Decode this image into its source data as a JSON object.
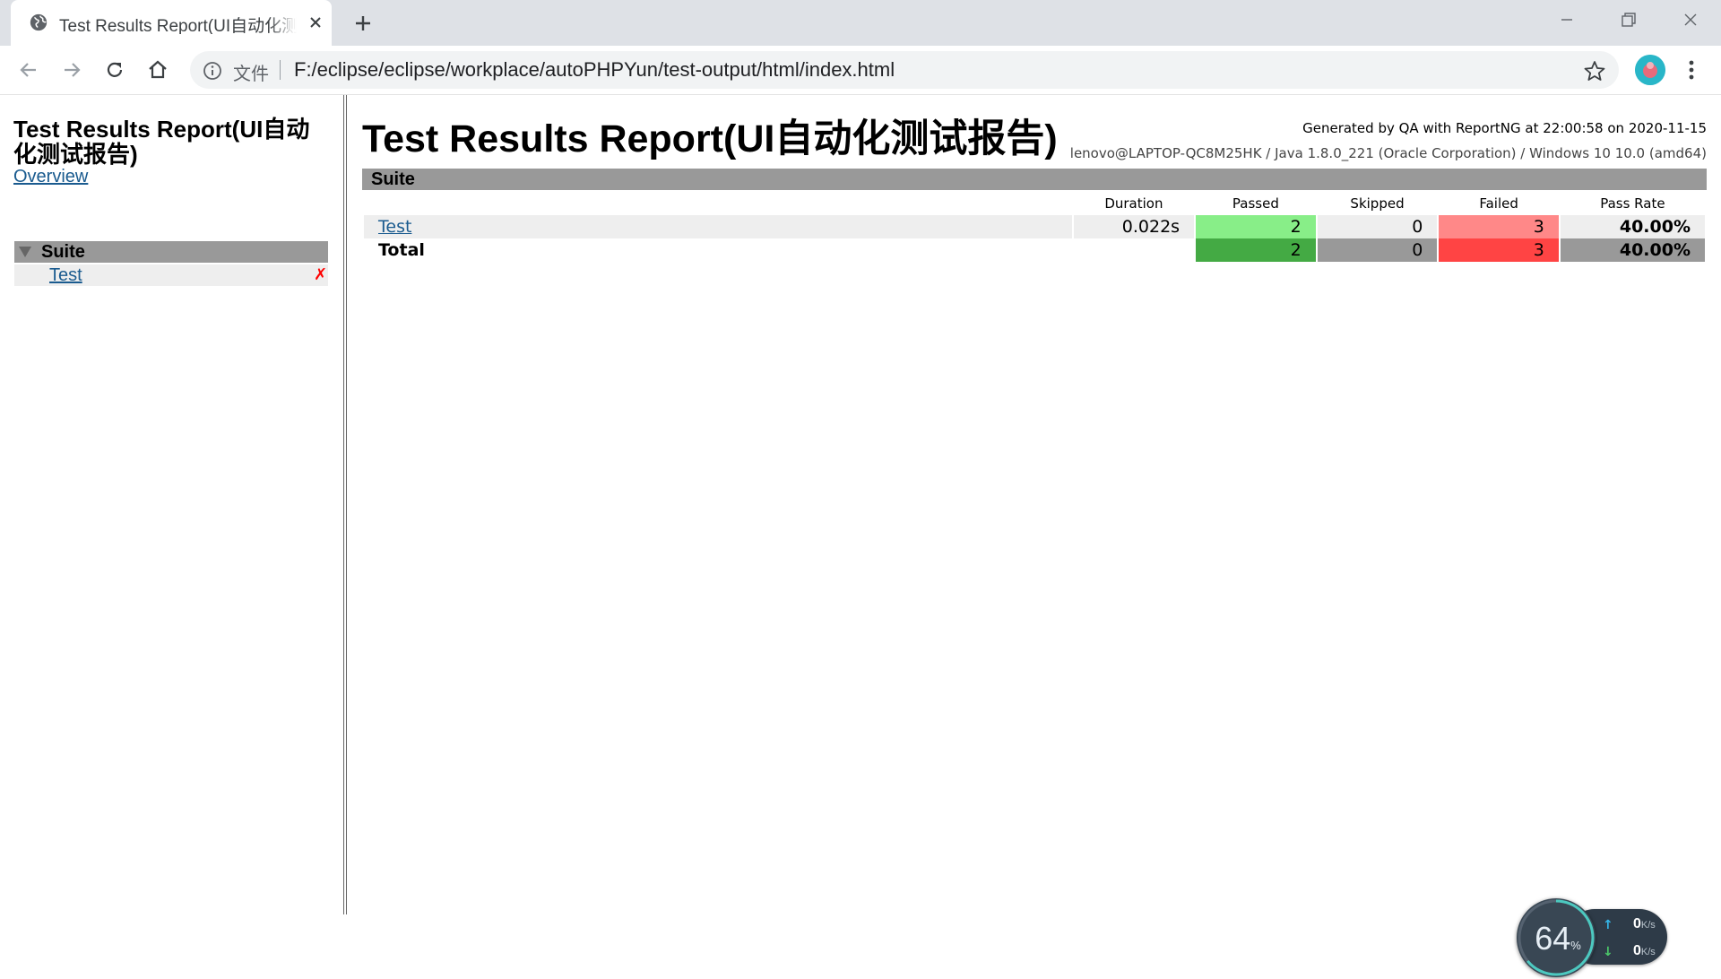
{
  "browser": {
    "tab_title": "Test Results Report(UI自动化测试报告)",
    "url_scheme": "文件",
    "url": "F:/eclipse/eclipse/workplace/autoPHPYun/test-output/html/index.html"
  },
  "sidebar": {
    "title": "Test Results Report(UI自动化测试报告)",
    "overview_link": "Overview",
    "suite_label": "Suite",
    "test_link": "Test",
    "fail_mark": "✗"
  },
  "report": {
    "title": "Test Results Report(UI自动化测试报告)",
    "generated_line": "Generated by QA with ReportNG at 22:00:58 on 2020-11-15",
    "system_line": "lenovo@LAPTOP-QC8M25HK / Java 1.8.0_221 (Oracle Corporation) / Windows 10 10.0 (amd64)",
    "suite_label": "Suite",
    "columns": [
      "Duration",
      "Passed",
      "Skipped",
      "Failed",
      "Pass Rate"
    ],
    "test_row": {
      "name": "Test",
      "duration": "0.022s",
      "passed": "2",
      "skipped": "0",
      "failed": "3",
      "pass_rate": "40.00%"
    },
    "total_row": {
      "label": "Total",
      "passed": "2",
      "skipped": "0",
      "failed": "3",
      "pass_rate": "40.00%"
    },
    "colors": {
      "passed_test": "#88ee88",
      "failed_test": "#ff8888",
      "passed_total": "#44aa44",
      "failed_total": "#ff4444",
      "header_gray": "#999999"
    }
  },
  "network_widget": {
    "percent": "64",
    "percent_unit": "%",
    "upload_value": "0",
    "download_value": "0",
    "unit": "K/s"
  }
}
